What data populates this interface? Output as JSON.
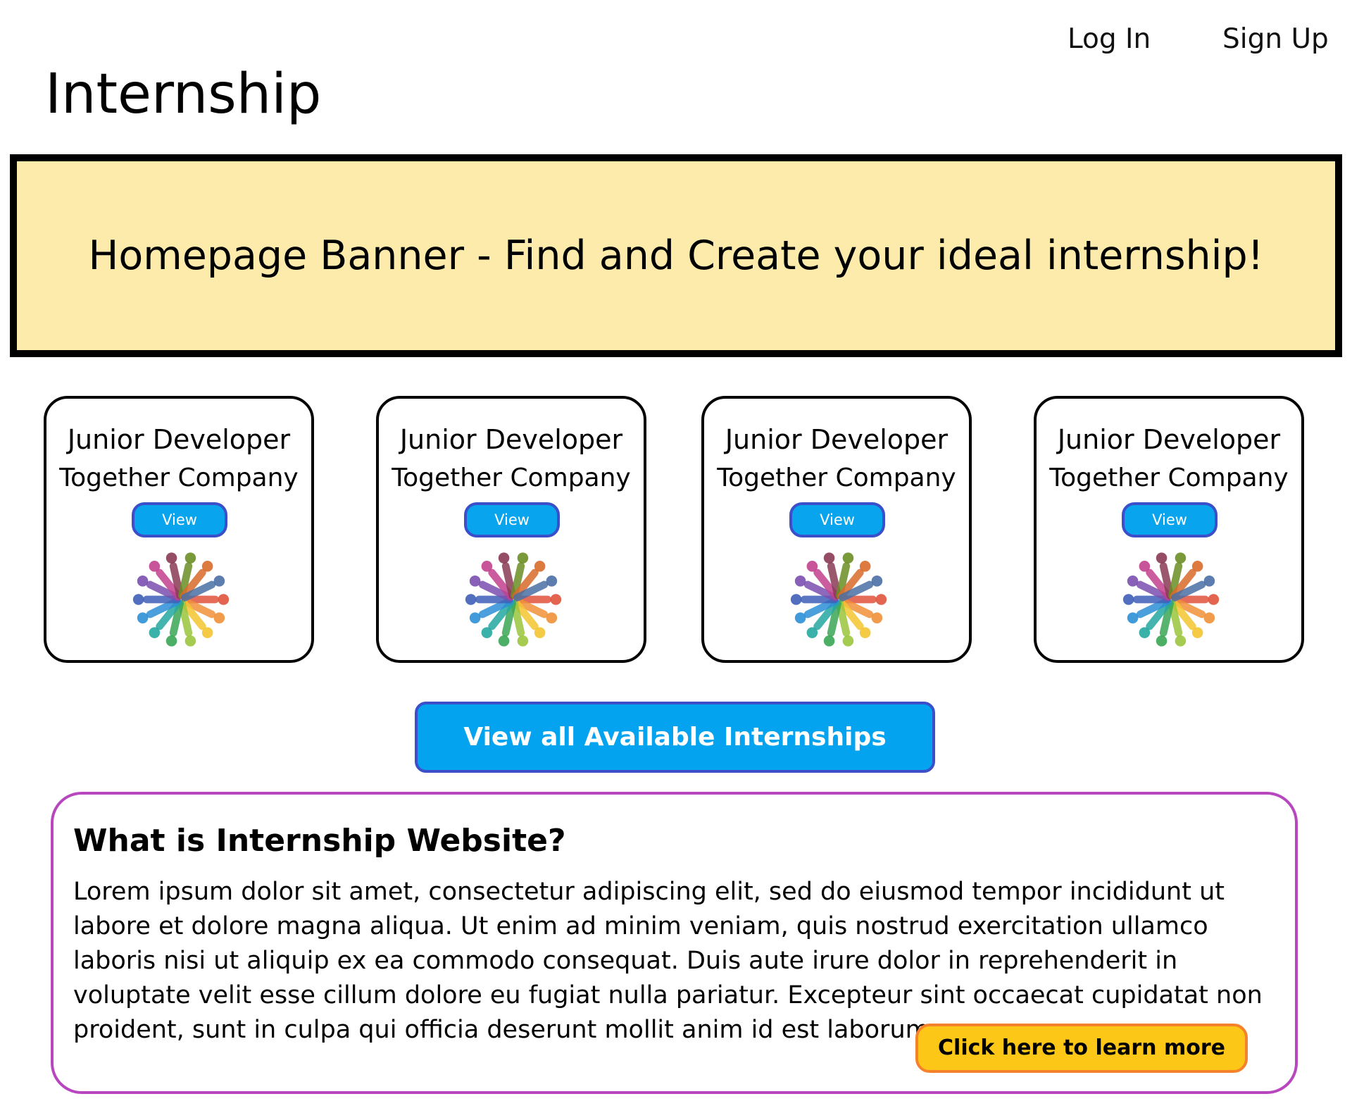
{
  "header": {
    "site_title": "Internship",
    "login_label": "Log In",
    "signup_label": "Sign Up"
  },
  "banner": {
    "text": "Homepage Banner - Find and Create your ideal internship!",
    "background_color": "#fcebaa"
  },
  "internships": [
    {
      "title": "Junior Developer",
      "company": "Together Company",
      "view_label": "View",
      "logo": "diverse-people-circle-icon"
    },
    {
      "title": "Junior Developer",
      "company": "Together Company",
      "view_label": "View",
      "logo": "diverse-people-circle-icon"
    },
    {
      "title": "Junior Developer",
      "company": "Together Company",
      "view_label": "View",
      "logo": "diverse-people-circle-icon"
    },
    {
      "title": "Junior Developer",
      "company": "Together Company",
      "view_label": "View",
      "logo": "diverse-people-circle-icon"
    }
  ],
  "cta": {
    "view_all_label": "View all Available Internships",
    "color": "#04a3ef"
  },
  "about": {
    "heading": "What is Internship Website?",
    "body": "Lorem ipsum dolor sit amet, consectetur adipiscing elit, sed do eiusmod tempor incididunt ut labore et dolore magna aliqua. Ut enim ad minim veniam, quis nostrud exercitation ullamco laboris nisi ut aliquip ex ea commodo consequat. Duis aute irure dolor in reprehenderit in voluptate velit esse cillum dolore eu fugiat nulla pariatur. Excepteur sint occaecat cupidatat non proident, sunt in culpa qui officia deserunt mollit anim id est laborum.",
    "learn_more_label": "Click here to learn more",
    "border_color": "#b746bf",
    "button_color": "#fdc717"
  }
}
